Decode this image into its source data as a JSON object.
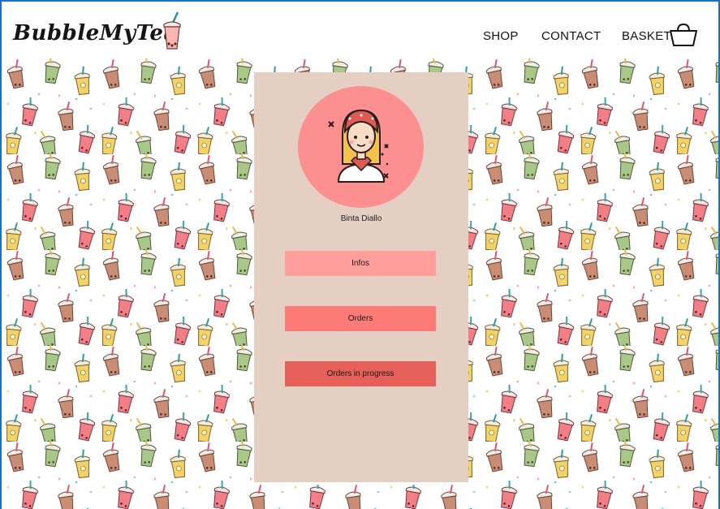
{
  "header": {
    "brand": "BubbleMyTea",
    "nav": {
      "shop": "SHOP",
      "contact": "CONTACT",
      "basket": "BASKET"
    }
  },
  "profile": {
    "name": "Binta Diallo",
    "buttons": {
      "infos": "Infos",
      "orders": "Orders",
      "in_progress": "Orders in progress"
    }
  },
  "icons": {
    "logo_cup": "bubble-tea-cup-icon",
    "basket": "basket-icon",
    "avatar": "girl-avatar-icon"
  },
  "colors": {
    "panel": "#e5cfc3",
    "avatar_bg": "#fc8f8f",
    "infos": "#fe9f9b",
    "orders": "#fd7b76",
    "in_progress": "#e6605a"
  }
}
